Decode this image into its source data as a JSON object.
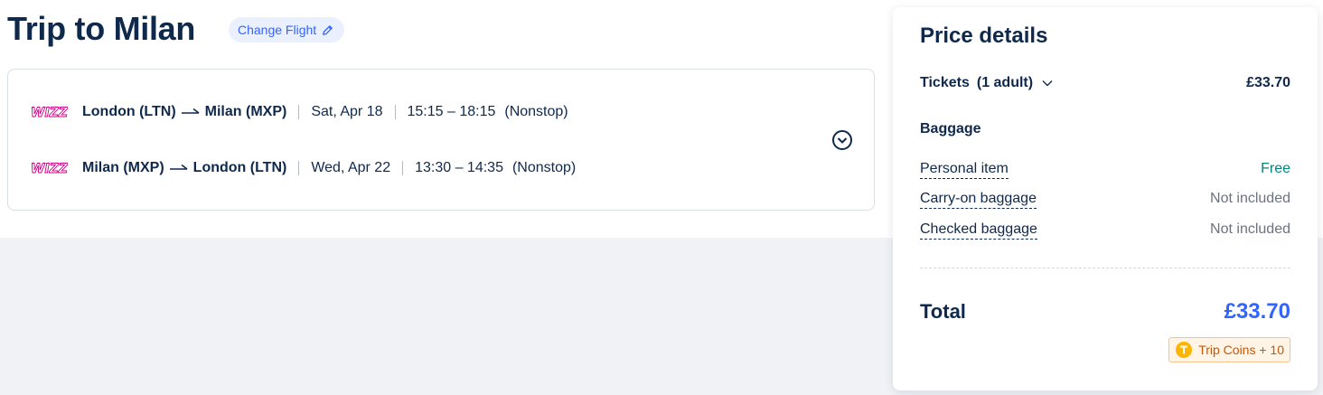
{
  "trip": {
    "title": "Trip to Milan",
    "change_flight_label": "Change Flight"
  },
  "flights": [
    {
      "airline": "Wizz Air",
      "from": "London (LTN)",
      "to": "Milan (MXP)",
      "date": "Sat, Apr 18",
      "time": "15:15 – 18:15",
      "stops": "(Nonstop)"
    },
    {
      "airline": "Wizz Air",
      "from": "Milan (MXP)",
      "to": "London (LTN)",
      "date": "Wed, Apr 22",
      "time": "13:30 – 14:35",
      "stops": "(Nonstop)"
    }
  ],
  "price_details": {
    "title": "Price details",
    "tickets_label": "Tickets",
    "tickets_count": "(1 adult)",
    "tickets_price": "£33.70",
    "baggage_heading": "Baggage",
    "baggage": [
      {
        "label": "Personal item",
        "value": "Free"
      },
      {
        "label": "Carry-on baggage",
        "value": "Not included"
      },
      {
        "label": "Checked baggage",
        "value": "Not included"
      }
    ],
    "total_label": "Total",
    "total_value": "£33.70",
    "coins_label": "Trip Coins + 10"
  },
  "icons": {
    "edit": "pencil-icon",
    "expand": "chevron-circle-down-icon",
    "tickets_chevron": "chevron-down-icon",
    "coin": "trip-coin-icon",
    "arrow": "arrow-right-icon",
    "logo": "wizz-air-logo-icon"
  },
  "colors": {
    "text": "#0f294d",
    "accent": "#3264ff",
    "free": "#00867a",
    "muted": "#6b7280",
    "coins": "#cc5500",
    "wizz_logo": "#c6007e"
  }
}
